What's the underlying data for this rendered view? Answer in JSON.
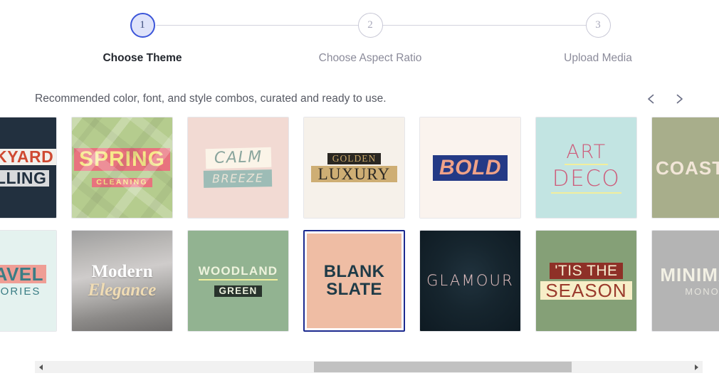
{
  "stepper": {
    "steps": [
      {
        "number": "1",
        "label": "Choose Theme",
        "state": "active"
      },
      {
        "number": "2",
        "label": "Choose Aspect Ratio",
        "state": "inactive"
      },
      {
        "number": "3",
        "label": "Upload Media",
        "state": "inactive"
      }
    ],
    "active_border_color": "#3b55d9",
    "active_fill_color": "#dfe3fa",
    "inactive_color": "#c8c8d6"
  },
  "section": {
    "description": "Recommended color, font, and style combos, curated and ready to use.",
    "prev_icon": "chevron-left-icon",
    "prev_label": "<",
    "next_icon": "chevron-right-icon",
    "next_label": ">"
  },
  "gallery": {
    "row1": [
      {
        "id": "backyard-grilling",
        "style": "c-grill",
        "texture": false,
        "line1": "BACKYARD",
        "line2": "GRILLING",
        "partial": "left"
      },
      {
        "id": "spring-cleaning",
        "style": "c-spring",
        "texture": true,
        "line1": "SPRING",
        "line2": "CLEANING",
        "partial": "none"
      },
      {
        "id": "calm-breeze",
        "style": "c-calm",
        "texture": false,
        "line1": "CALM",
        "line2": "BREEZE",
        "partial": "none"
      },
      {
        "id": "golden-luxury",
        "style": "c-gold",
        "texture": false,
        "line1": "GOLDEN",
        "line2": "LUXURY",
        "partial": "none"
      },
      {
        "id": "bold",
        "style": "c-bold",
        "texture": false,
        "line1": "BOLD",
        "line2": "",
        "partial": "none"
      },
      {
        "id": "art-deco",
        "style": "c-deco",
        "texture": false,
        "line1": "ART",
        "line2": "DECO",
        "partial": "none"
      },
      {
        "id": "coastal",
        "style": "c-coast",
        "texture": false,
        "line1": "COASTAL",
        "line2": "",
        "partial": "right"
      }
    ],
    "row2": [
      {
        "id": "travel-memories",
        "style": "c-travel",
        "texture": false,
        "line1": "TRAVEL",
        "line2": "MEMORIES",
        "partial": "left"
      },
      {
        "id": "modern-elegance",
        "style": "c-modern",
        "texture": false,
        "line1": "Modern",
        "line2": "Elegance",
        "partial": "none"
      },
      {
        "id": "woodland-green",
        "style": "c-wood",
        "texture": false,
        "line1": "WOODLAND",
        "line2": "GREEN",
        "partial": "none"
      },
      {
        "id": "blank-slate",
        "style": "c-blank",
        "texture": false,
        "line1": "BLANK",
        "line2": "SLATE",
        "partial": "none",
        "selected": true
      },
      {
        "id": "glamour",
        "style": "c-glam",
        "texture": false,
        "line1": "GLAMOUR",
        "line2": "",
        "partial": "none"
      },
      {
        "id": "tis-the-season",
        "style": "c-season",
        "texture": false,
        "line1": "'TIS THE",
        "line2": "SEASON",
        "partial": "none"
      },
      {
        "id": "minimal-mono",
        "style": "c-mono",
        "texture": false,
        "line1": "MINIMAL",
        "line2": "MONO",
        "partial": "right"
      }
    ],
    "selected_theme": "BLANK SLATE",
    "selection_color": "#1c2a8f"
  },
  "scrollbar": {
    "orientation": "horizontal",
    "left_arrow_icon": "triangle-left-icon",
    "right_arrow_icon": "triangle-right-icon",
    "thumb_left_pct": 41.5,
    "thumb_width_pct": 40.0,
    "track_color": "#f1f1f1",
    "thumb_color": "#c1c1c1"
  }
}
